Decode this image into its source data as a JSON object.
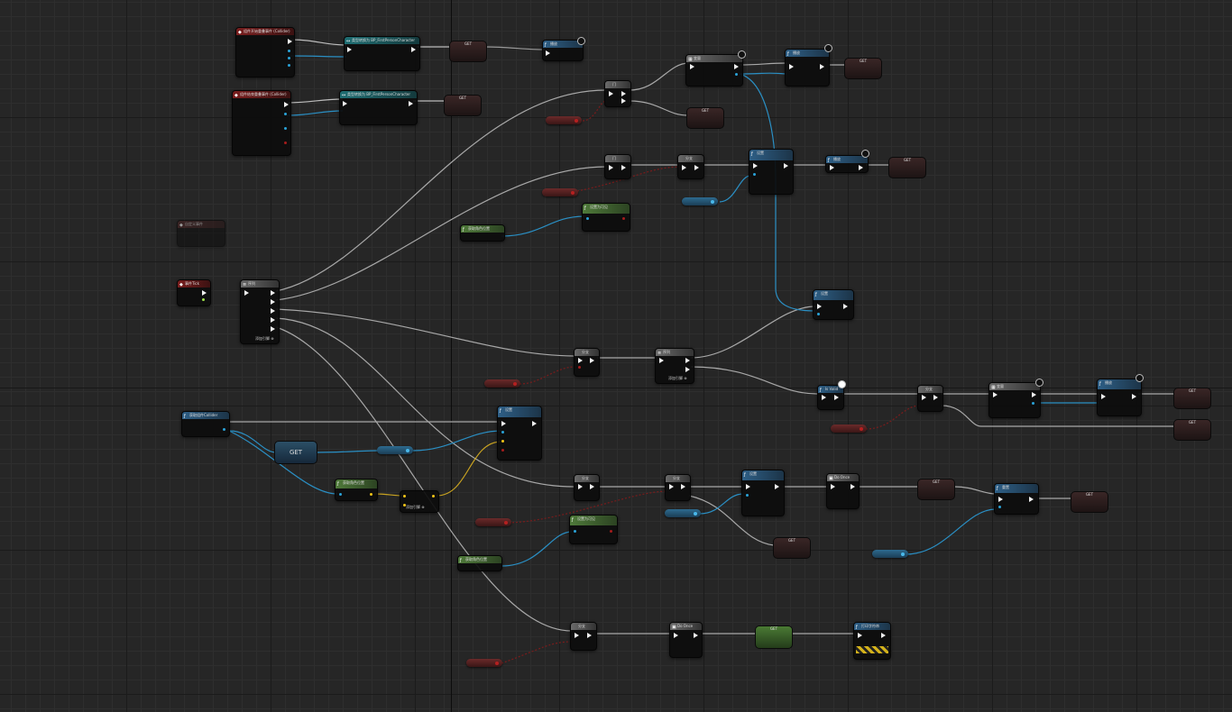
{
  "canvas": {
    "label": "Blueprint event graph"
  },
  "nodes": {
    "get_labels": {
      "a": "GET",
      "b": "GET",
      "c": "GET",
      "d": "GET",
      "e": "GET",
      "f": "GET",
      "g": "GET",
      "h": "GET",
      "i": "GET",
      "j": "GET",
      "k": "GET",
      "l": "GET",
      "m": "GET",
      "big": "GET"
    },
    "event_box_1": "组件开始重叠事件 (Collider)",
    "event_box_2": "组件结束重叠事件 (Collider)",
    "cast_1": "类型转换为 BP_FirstPersonCharacter",
    "cast_2": "类型转换为 BP_FirstPersonCharacter",
    "event_tick": "事件Tick",
    "sequence_1": "序列",
    "add_pin_1": "添加引脚 ⊕",
    "add_pin_2": "添加引脚 ⊕",
    "add_pin_3": "添加引脚 ⊕",
    "branch": "分支",
    "do_once_1": "Do Once",
    "do_once_2": "Do Once",
    "is_valid": "Is Valid",
    "get_collider": "获取组件Collider",
    "set_label": "设置",
    "var_label": "变量",
    "play_label": "播放",
    "dim_event": "自定义事件",
    "green_a": "设置为可见",
    "green_b": "获取角色位置",
    "green_c": "获取角色位置",
    "print": "打印字符串",
    "gate": "门",
    "reset_label": "重置"
  },
  "colors": {
    "event": "#7a1e1e",
    "cast": "#1f6e73",
    "function": "#2e5f86",
    "pure": "#4f7a3a",
    "flow": "#6a6a6a",
    "exec_pin": "#f0f0f0",
    "object_pin": "#2aa3d8",
    "bool_pin": "#a51c1c",
    "float_pin": "#9ee04a",
    "vector_pin": "#f2c418"
  }
}
